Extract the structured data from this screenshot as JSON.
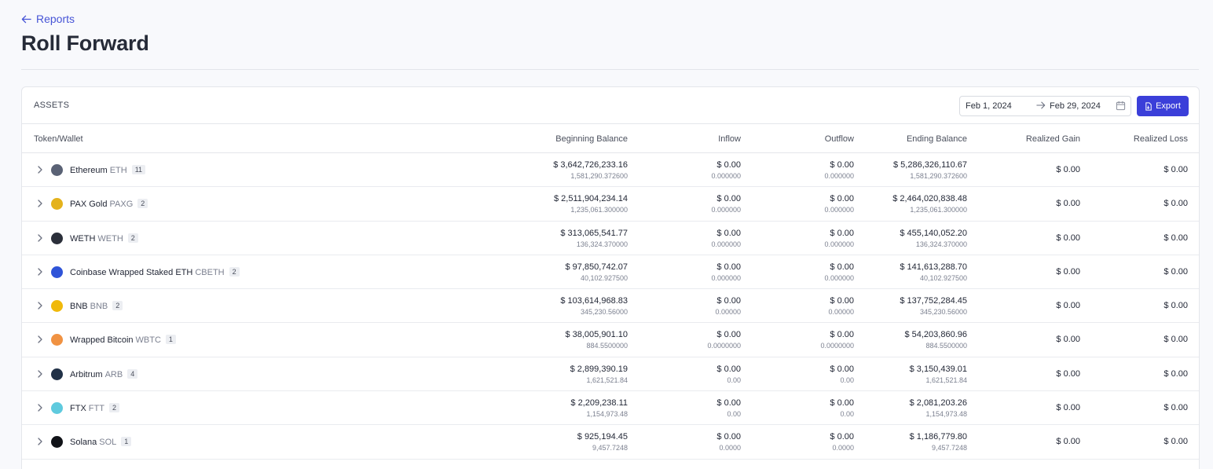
{
  "nav": {
    "back_label": "Reports"
  },
  "page": {
    "title": "Roll Forward"
  },
  "card": {
    "label": "ASSETS",
    "date_start": "Feb 1, 2024",
    "date_end": "Feb 29, 2024",
    "export_label": "Export"
  },
  "columns": {
    "token": "Token/Wallet",
    "beginning": "Beginning Balance",
    "inflow": "Inflow",
    "outflow": "Outflow",
    "ending": "Ending Balance",
    "gain": "Realized Gain",
    "loss": "Realized Loss"
  },
  "rows": [
    {
      "name": "Ethereum",
      "symbol": "ETH",
      "count": "11",
      "icon": "ethereum-icon",
      "color": "#5a6275",
      "begin": "$ 3,642,726,233.16",
      "begin_qty": "1,581,290.372600",
      "inflow": "$ 0.00",
      "inflow_qty": "0.000000",
      "outflow": "$ 0.00",
      "outflow_qty": "0.000000",
      "end": "$ 5,286,326,110.67",
      "end_qty": "1,581,290.372600",
      "gain": "$ 0.00",
      "loss": "$ 0.00"
    },
    {
      "name": "PAX Gold",
      "symbol": "PAXG",
      "count": "2",
      "icon": "pax-gold-icon",
      "color": "#e4b21c",
      "begin": "$ 2,511,904,234.14",
      "begin_qty": "1,235,061.300000",
      "inflow": "$ 0.00",
      "inflow_qty": "0.000000",
      "outflow": "$ 0.00",
      "outflow_qty": "0.000000",
      "end": "$ 2,464,020,838.48",
      "end_qty": "1,235,061.300000",
      "gain": "$ 0.00",
      "loss": "$ 0.00"
    },
    {
      "name": "WETH",
      "symbol": "WETH",
      "count": "2",
      "icon": "weth-icon",
      "color": "#2b2f3a",
      "begin": "$ 313,065,541.77",
      "begin_qty": "136,324.370000",
      "inflow": "$ 0.00",
      "inflow_qty": "0.000000",
      "outflow": "$ 0.00",
      "outflow_qty": "0.000000",
      "end": "$ 455,140,052.20",
      "end_qty": "136,324.370000",
      "gain": "$ 0.00",
      "loss": "$ 0.00"
    },
    {
      "name": "Coinbase Wrapped Staked ETH",
      "symbol": "CBETH",
      "count": "2",
      "icon": "cbeth-icon",
      "color": "#2f54d8",
      "begin": "$ 97,850,742.07",
      "begin_qty": "40,102.927500",
      "inflow": "$ 0.00",
      "inflow_qty": "0.000000",
      "outflow": "$ 0.00",
      "outflow_qty": "0.000000",
      "end": "$ 141,613,288.70",
      "end_qty": "40,102.927500",
      "gain": "$ 0.00",
      "loss": "$ 0.00"
    },
    {
      "name": "BNB",
      "symbol": "BNB",
      "count": "2",
      "icon": "bnb-icon",
      "color": "#f0b90b",
      "begin": "$ 103,614,968.83",
      "begin_qty": "345,230.56000",
      "inflow": "$ 0.00",
      "inflow_qty": "0.00000",
      "outflow": "$ 0.00",
      "outflow_qty": "0.00000",
      "end": "$ 137,752,284.45",
      "end_qty": "345,230.56000",
      "gain": "$ 0.00",
      "loss": "$ 0.00"
    },
    {
      "name": "Wrapped Bitcoin",
      "symbol": "WBTC",
      "count": "1",
      "icon": "wbtc-icon",
      "color": "#f09242",
      "begin": "$ 38,005,901.10",
      "begin_qty": "884.5500000",
      "inflow": "$ 0.00",
      "inflow_qty": "0.0000000",
      "outflow": "$ 0.00",
      "outflow_qty": "0.0000000",
      "end": "$ 54,203,860.96",
      "end_qty": "884.5500000",
      "gain": "$ 0.00",
      "loss": "$ 0.00"
    },
    {
      "name": "Arbitrum",
      "symbol": "ARB",
      "count": "4",
      "icon": "arbitrum-icon",
      "color": "#213147",
      "begin": "$ 2,899,390.19",
      "begin_qty": "1,621,521.84",
      "inflow": "$ 0.00",
      "inflow_qty": "0.00",
      "outflow": "$ 0.00",
      "outflow_qty": "0.00",
      "end": "$ 3,150,439.01",
      "end_qty": "1,621,521.84",
      "gain": "$ 0.00",
      "loss": "$ 0.00"
    },
    {
      "name": "FTX",
      "symbol": "FTT",
      "count": "2",
      "icon": "ftx-icon",
      "color": "#5fcade",
      "begin": "$ 2,209,238.11",
      "begin_qty": "1,154,973.48",
      "inflow": "$ 0.00",
      "inflow_qty": "0.00",
      "outflow": "$ 0.00",
      "outflow_qty": "0.00",
      "end": "$ 2,081,203.26",
      "end_qty": "1,154,973.48",
      "gain": "$ 0.00",
      "loss": "$ 0.00"
    },
    {
      "name": "Solana",
      "symbol": "SOL",
      "count": "1",
      "icon": "solana-icon",
      "color": "#111318",
      "begin": "$ 925,194.45",
      "begin_qty": "9,457.7248",
      "inflow": "$ 0.00",
      "inflow_qty": "0.0000",
      "outflow": "$ 0.00",
      "outflow_qty": "0.0000",
      "end": "$ 1,186,779.80",
      "end_qty": "9,457.7248",
      "gain": "$ 0.00",
      "loss": "$ 0.00"
    }
  ]
}
